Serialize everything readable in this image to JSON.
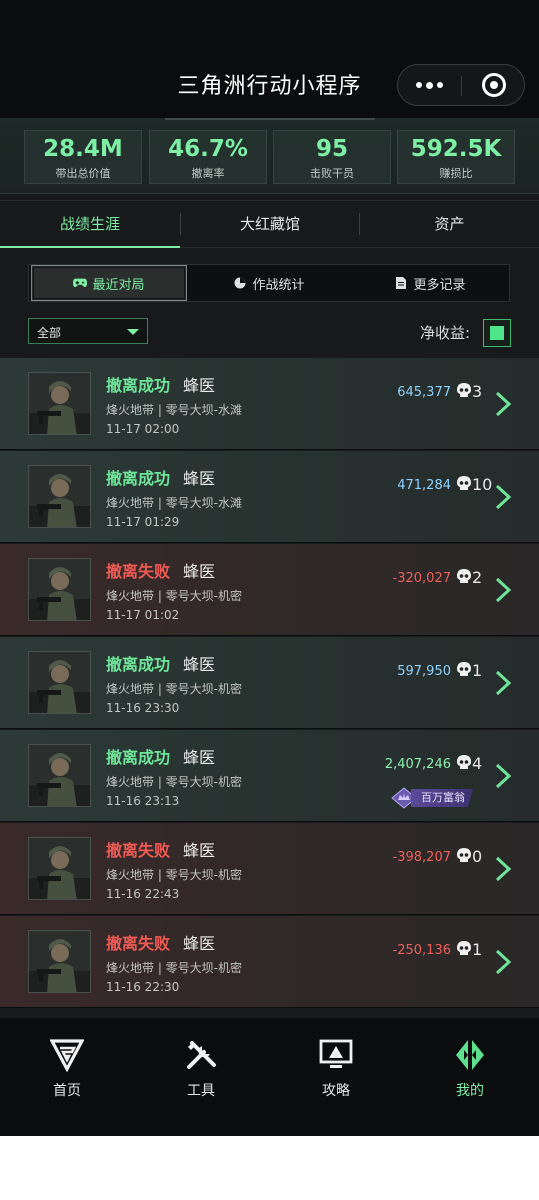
{
  "header": {
    "title": "三角洲行动小程序"
  },
  "stats": [
    {
      "value": "28.4M",
      "label": "带出总价值"
    },
    {
      "value": "46.7%",
      "label": "撤离率"
    },
    {
      "value": "95",
      "label": "击败干员"
    },
    {
      "value": "592.5K",
      "label": "赚损比"
    }
  ],
  "main_tabs": [
    {
      "label": "战绩生涯",
      "active": true
    },
    {
      "label": "大红藏馆",
      "active": false
    },
    {
      "label": "资产",
      "active": false
    }
  ],
  "sub_tabs": [
    {
      "label": "最近对局",
      "icon": "gamepad-icon",
      "active": true
    },
    {
      "label": "作战统计",
      "icon": "pie-chart-icon",
      "active": false
    },
    {
      "label": "更多记录",
      "icon": "document-icon",
      "active": false
    }
  ],
  "filter": {
    "selected": "全部"
  },
  "net_income": {
    "label": "净收益:",
    "checked": true
  },
  "matches": [
    {
      "status": "撤离成功",
      "result": "ok",
      "role": "蜂医",
      "map": "烽火地带 | 零号大坝-水滩",
      "time": "11-17 02:00",
      "income": "645,377",
      "kills": "3"
    },
    {
      "status": "撤离成功",
      "result": "ok",
      "role": "蜂医",
      "map": "烽火地带 | 零号大坝-水滩",
      "time": "11-17 01:29",
      "income": "471,284",
      "kills": "10"
    },
    {
      "status": "撤离失败",
      "result": "fail",
      "role": "蜂医",
      "map": "烽火地带 | 零号大坝-机密",
      "time": "11-17 01:02",
      "income": "-320,027",
      "kills": "2"
    },
    {
      "status": "撤离成功",
      "result": "ok",
      "role": "蜂医",
      "map": "烽火地带 | 零号大坝-机密",
      "time": "11-16 23:30",
      "income": "597,950",
      "kills": "1"
    },
    {
      "status": "撤离成功",
      "result": "ok",
      "role": "蜂医",
      "map": "烽火地带 | 零号大坝-机密",
      "time": "11-16 23:13",
      "income": "2,407,246",
      "kills": "4",
      "badge": "百万富翁"
    },
    {
      "status": "撤离失败",
      "result": "fail",
      "role": "蜂医",
      "map": "烽火地带 | 零号大坝-机密",
      "time": "11-16 22:43",
      "income": "-398,207",
      "kills": "0"
    },
    {
      "status": "撤离失败",
      "result": "fail",
      "role": "蜂医",
      "map": "烽火地带 | 零号大坝-机密",
      "time": "11-16 22:30",
      "income": "-250,136",
      "kills": "1"
    }
  ],
  "bottom_nav": [
    {
      "label": "首页",
      "icon": "home-logo-icon",
      "active": false
    },
    {
      "label": "工具",
      "icon": "tools-icon",
      "active": false
    },
    {
      "label": "攻略",
      "icon": "guide-monitor-icon",
      "active": false
    },
    {
      "label": "我的",
      "icon": "profile-logo-icon",
      "active": true
    }
  ],
  "colors": {
    "accent": "#7ef0a6",
    "success": "#6fe59a",
    "fail": "#ef5a55",
    "income_positive": "#8fd1ff",
    "income_negative": "#f0605a",
    "background": "#17191b"
  }
}
